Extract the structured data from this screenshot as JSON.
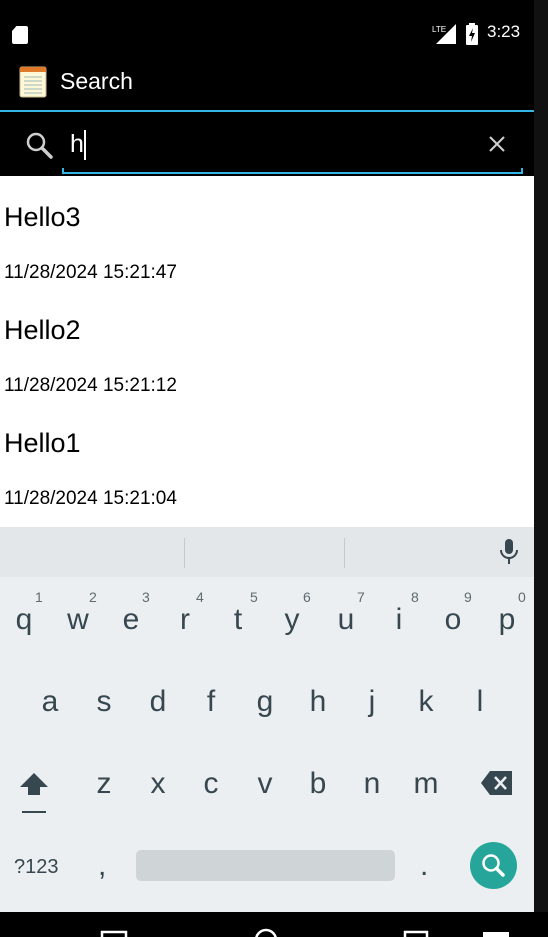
{
  "status_bar": {
    "time": "3:23",
    "network": "LTE",
    "icons": [
      "sd-card-icon",
      "lte-signal-icon",
      "battery-charging-icon"
    ]
  },
  "action_bar": {
    "title": "Search",
    "icon": "notepad-icon"
  },
  "search": {
    "query": "h",
    "icon": "search-icon",
    "clear_icon": "close-icon",
    "accent_color": "#33b5e5"
  },
  "results": [
    {
      "title": "Hello3",
      "date": "11/28/2024 15:21:47"
    },
    {
      "title": "Hello2",
      "date": "11/28/2024 15:21:12"
    },
    {
      "title": "Hello1",
      "date": "11/28/2024 15:21:04"
    }
  ],
  "keyboard": {
    "row1": [
      {
        "key": "q",
        "hint": "1"
      },
      {
        "key": "w",
        "hint": "2"
      },
      {
        "key": "e",
        "hint": "3"
      },
      {
        "key": "r",
        "hint": "4"
      },
      {
        "key": "t",
        "hint": "5"
      },
      {
        "key": "y",
        "hint": "6"
      },
      {
        "key": "u",
        "hint": "7"
      },
      {
        "key": "i",
        "hint": "8"
      },
      {
        "key": "o",
        "hint": "9"
      },
      {
        "key": "p",
        "hint": "0"
      }
    ],
    "row2": [
      "a",
      "s",
      "d",
      "f",
      "g",
      "h",
      "j",
      "k",
      "l"
    ],
    "row3": [
      "z",
      "x",
      "c",
      "v",
      "b",
      "n",
      "m"
    ],
    "mode_label": "?123",
    "comma": ",",
    "period": ".",
    "action_color": "#26a69a"
  }
}
